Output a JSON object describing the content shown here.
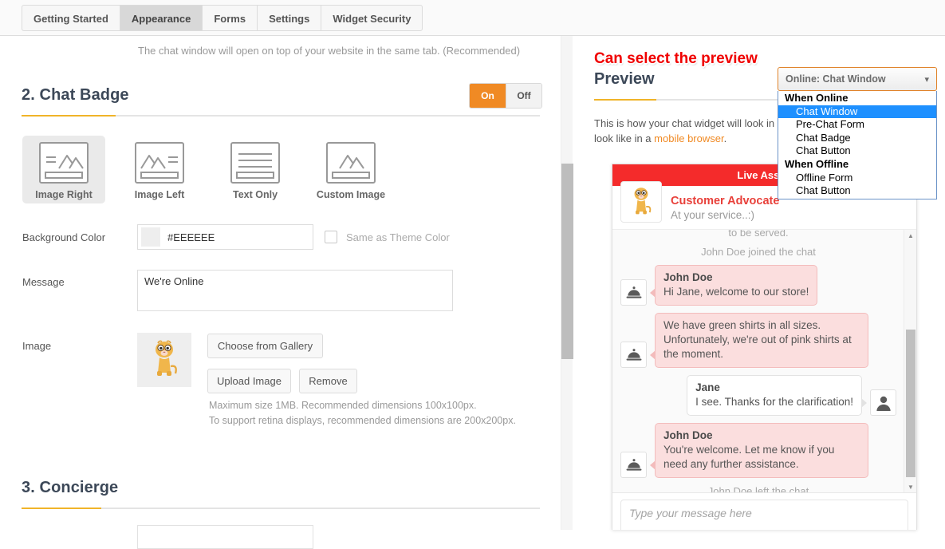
{
  "tabs": [
    {
      "label": "Getting Started",
      "active": false
    },
    {
      "label": "Appearance",
      "active": true
    },
    {
      "label": "Forms",
      "active": false
    },
    {
      "label": "Settings",
      "active": false
    },
    {
      "label": "Widget Security",
      "active": false
    }
  ],
  "left": {
    "top_note": "The chat window will open on top of your website in the same tab. (Recommended)",
    "chat_badge": {
      "heading": "2. Chat Badge",
      "toggle": {
        "on": "On",
        "off": "Off",
        "state": "On"
      },
      "layout_options": [
        {
          "label": "Image Right",
          "icon": "badge-image-right-icon",
          "selected": true
        },
        {
          "label": "Image Left",
          "icon": "badge-image-left-icon",
          "selected": false
        },
        {
          "label": "Text Only",
          "icon": "badge-text-only-icon",
          "selected": false
        },
        {
          "label": "Custom Image",
          "icon": "badge-custom-image-icon",
          "selected": false
        }
      ],
      "background_color": {
        "label": "Background Color",
        "value": "#EEEEEE",
        "swatch": "#EEEEEE",
        "same_as_theme_label": "Same as Theme Color",
        "same_as_theme_checked": false
      },
      "message": {
        "label": "Message",
        "value": "We're Online"
      },
      "image": {
        "label": "Image",
        "choose_label": "Choose from Gallery",
        "upload_label": "Upload Image",
        "remove_label": "Remove",
        "hint_line1": "Maximum size 1MB. Recommended dimensions 100x100px.",
        "hint_line2": "To support retina displays, recommended dimensions are 200x200px."
      }
    },
    "concierge": {
      "heading": "3. Concierge"
    }
  },
  "right": {
    "annotation": "Can select the preview",
    "heading": "Preview",
    "description_part1": "This is how your chat widget will look in",
    "description_part2": "it'll look like in a ",
    "description_link": "mobile browser",
    "description_part3": ".",
    "preview_select": {
      "value": "Online: Chat Window",
      "caret": "chevron-down-icon",
      "groups": [
        {
          "label": "When Online",
          "options": [
            {
              "label": "Chat Window",
              "highlighted": true
            },
            {
              "label": "Pre-Chat Form",
              "highlighted": false
            },
            {
              "label": "Chat Badge",
              "highlighted": false
            },
            {
              "label": "Chat Button",
              "highlighted": false
            }
          ]
        },
        {
          "label": "When Offline",
          "options": [
            {
              "label": "Offline Form",
              "highlighted": false
            },
            {
              "label": "Chat Button",
              "highlighted": false
            }
          ]
        }
      ]
    },
    "widget": {
      "title_bar": "Live Assist",
      "agent_name": "Customer Advocate",
      "agent_tagline": "At your service..:)",
      "messages": [
        {
          "type": "system",
          "text": "to be served.",
          "clipped": true
        },
        {
          "type": "system",
          "text": "John Doe joined the chat"
        },
        {
          "type": "agent",
          "who": "John Doe",
          "text": "Hi Jane, welcome to our store!"
        },
        {
          "type": "agent",
          "who": "",
          "text": "We have green shirts in all sizes. Unfortunately, we're out of pink shirts at the moment."
        },
        {
          "type": "user",
          "who": "Jane",
          "text": "I see. Thanks for the clarification!"
        },
        {
          "type": "agent",
          "who": "John Doe",
          "text": "You're welcome. Let me know if you need any further assistance."
        },
        {
          "type": "system",
          "text": "John Doe left the chat"
        }
      ],
      "input_placeholder": "Type your message here"
    }
  },
  "colors": {
    "accent_orange": "#f08a24",
    "accent_yellow": "#f0b429",
    "widget_red": "#f42b2b",
    "agent_name_red": "#e8403a",
    "highlight_blue": "#1e90ff",
    "annotation_red": "#f00000"
  }
}
